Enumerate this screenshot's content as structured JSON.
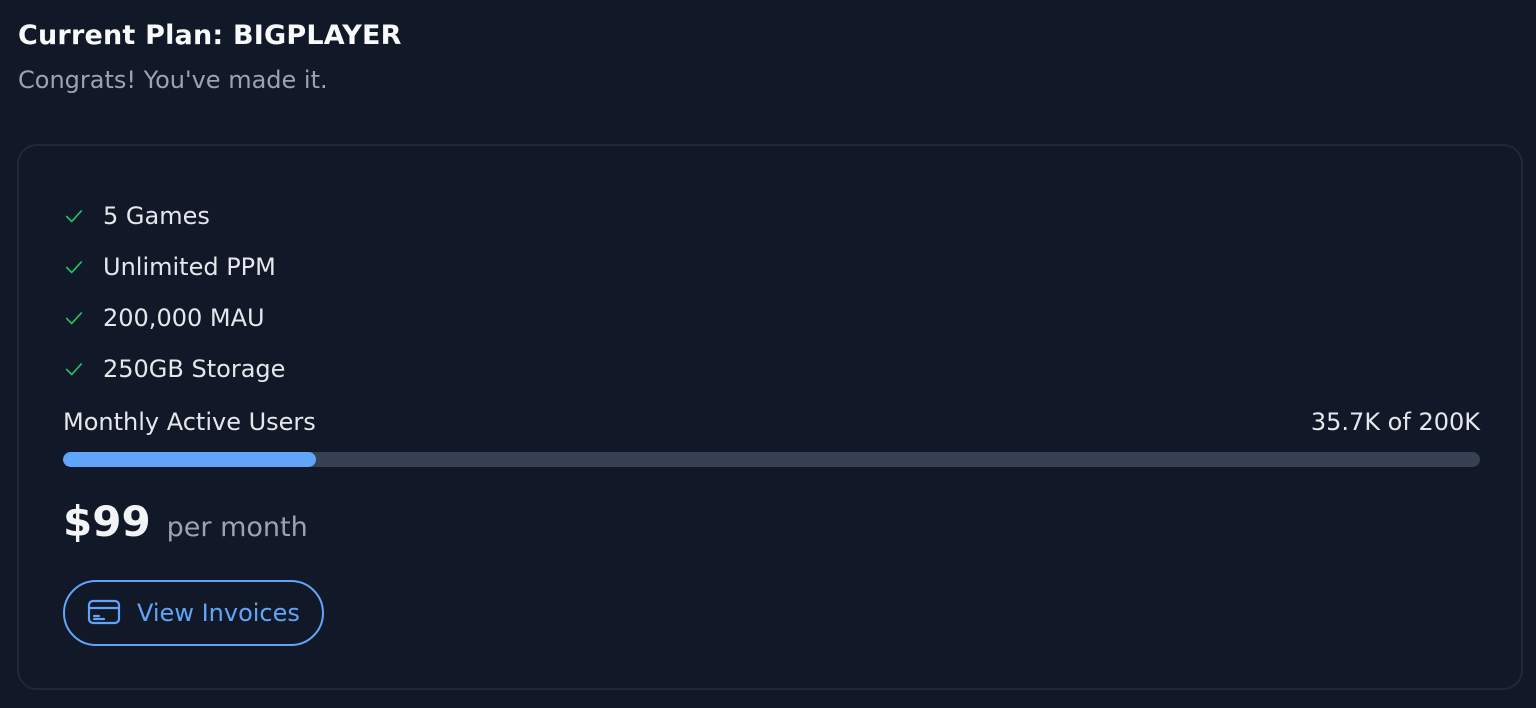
{
  "header": {
    "title": "Current Plan: BIGPLAYER",
    "subtitle": "Congrats! You've made it."
  },
  "features": [
    {
      "label": "5 Games",
      "icon": "check-icon"
    },
    {
      "label": "Unlimited PPM",
      "icon": "check-icon"
    },
    {
      "label": "200,000 MAU",
      "icon": "check-icon"
    },
    {
      "label": "250GB Storage",
      "icon": "check-icon"
    }
  ],
  "usage": {
    "label": "Monthly Active Users",
    "value_text": "35.7K of 200K",
    "progress_fraction": 0.1785
  },
  "price": {
    "amount": "$99",
    "period": "per month"
  },
  "actions": {
    "view_invoices_label": "View Invoices",
    "view_invoices_icon": "credit-card-icon"
  },
  "colors": {
    "background": "#111827",
    "accent": "#60a5fa",
    "success": "#22c55e",
    "track": "#374151"
  }
}
